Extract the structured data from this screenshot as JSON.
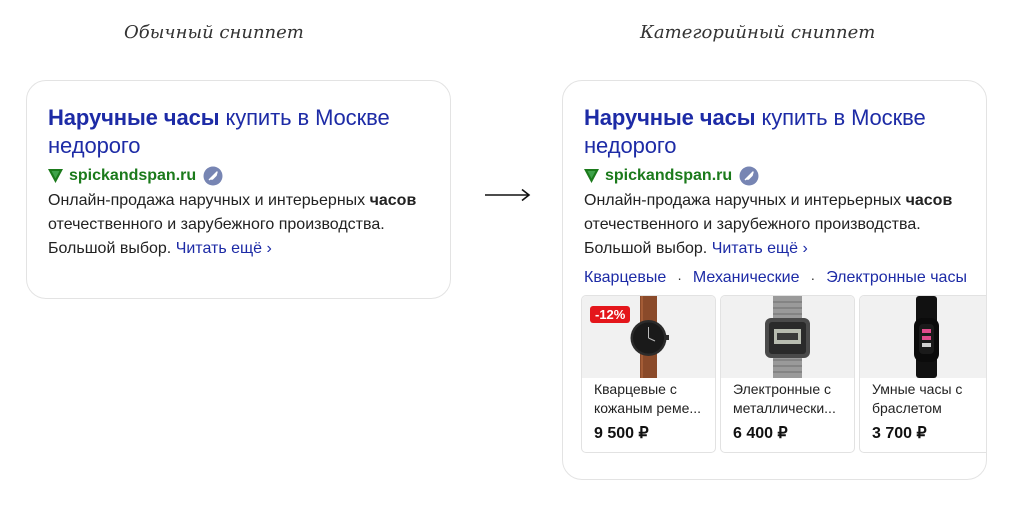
{
  "captions": {
    "left": "Обычный сниппет",
    "right": "Категорийный сниппет"
  },
  "snippet": {
    "title_bold": "Наручные часы",
    "title_rest": " купить в Москве недорого",
    "domain": "spickandspan.ru",
    "desc_part1": "Онлайн-продажа наручных и интерьерных ",
    "desc_bold": "часов",
    "desc_part2": " отечественного и зарубежного производства. Большой выбор. ",
    "read_more": "Читать ещё ›"
  },
  "categories": [
    "Кварцевые",
    "Механические",
    "Электронные часы"
  ],
  "separator": "·",
  "products": [
    {
      "name": "Кварцевые с кожаным реме...",
      "price": "9 500 ₽",
      "discount": "-12%",
      "icon": "leather-watch-icon"
    },
    {
      "name": "Электронные с металлически...",
      "price": "6 400 ₽",
      "icon": "digital-watch-icon"
    },
    {
      "name": "Умные часы с браслетом",
      "price": "3 700 ₽",
      "icon": "smart-band-icon"
    }
  ],
  "icons": {
    "arrow": "right-arrow-icon",
    "logo": "v-logo-icon",
    "badge": "verified-rocket-icon"
  },
  "colors": {
    "link": "#1d2ba6",
    "domain": "#1b7a1b",
    "discount": "#e4161b"
  }
}
